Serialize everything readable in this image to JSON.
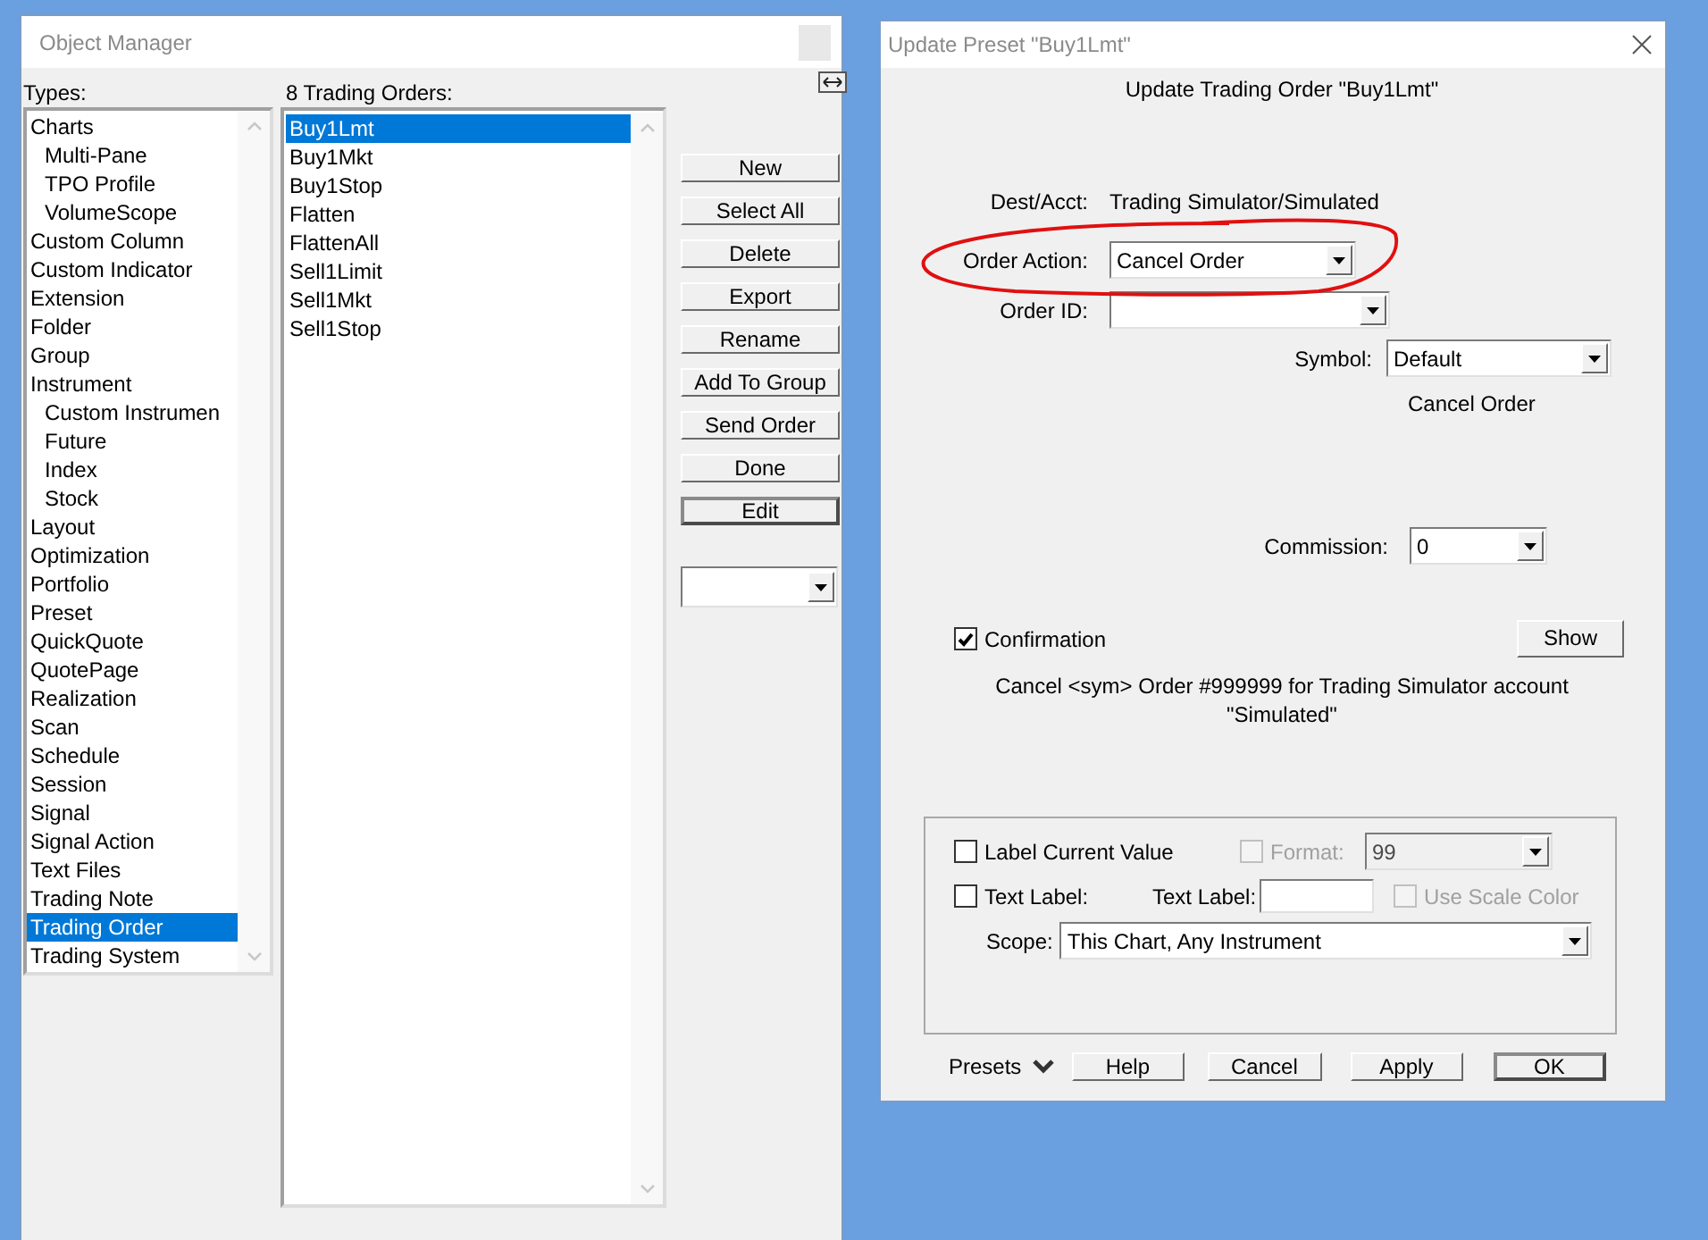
{
  "object_manager": {
    "title": "Object Manager",
    "types_label": "Types:",
    "types": [
      {
        "label": "Charts",
        "selected": false,
        "children": [
          {
            "label": "Multi-Pane",
            "selected": false
          },
          {
            "label": "TPO Profile",
            "selected": false
          },
          {
            "label": "VolumeScope",
            "selected": false
          }
        ]
      },
      {
        "label": "Custom Column",
        "selected": false
      },
      {
        "label": "Custom Indicator",
        "selected": false
      },
      {
        "label": "Extension",
        "selected": false
      },
      {
        "label": "Folder",
        "selected": false
      },
      {
        "label": "Group",
        "selected": false
      },
      {
        "label": "Instrument",
        "selected": false,
        "children": [
          {
            "label": "Custom Instrumen",
            "selected": false
          },
          {
            "label": "Future",
            "selected": false
          },
          {
            "label": "Index",
            "selected": false
          },
          {
            "label": "Stock",
            "selected": false
          }
        ]
      },
      {
        "label": "Layout",
        "selected": false
      },
      {
        "label": "Optimization",
        "selected": false
      },
      {
        "label": "Portfolio",
        "selected": false
      },
      {
        "label": "Preset",
        "selected": false
      },
      {
        "label": "QuickQuote",
        "selected": false
      },
      {
        "label": "QuotePage",
        "selected": false
      },
      {
        "label": "Realization",
        "selected": false
      },
      {
        "label": "Scan",
        "selected": false
      },
      {
        "label": "Schedule",
        "selected": false
      },
      {
        "label": "Session",
        "selected": false
      },
      {
        "label": "Signal",
        "selected": false
      },
      {
        "label": "Signal Action",
        "selected": false
      },
      {
        "label": "Text Files",
        "selected": false
      },
      {
        "label": "Trading Note",
        "selected": false
      },
      {
        "label": "Trading Order",
        "selected": true
      },
      {
        "label": "Trading System",
        "selected": false
      }
    ],
    "orders_label": "8 Trading Orders:",
    "orders": [
      {
        "label": "Buy1Lmt",
        "selected": true
      },
      {
        "label": "Buy1Mkt",
        "selected": false
      },
      {
        "label": "Buy1Stop",
        "selected": false
      },
      {
        "label": "Flatten",
        "selected": false
      },
      {
        "label": "FlattenAll",
        "selected": false
      },
      {
        "label": "Sell1Limit",
        "selected": false
      },
      {
        "label": "Sell1Mkt",
        "selected": false
      },
      {
        "label": "Sell1Stop",
        "selected": false
      }
    ],
    "buttons": [
      {
        "label": "New",
        "default": false
      },
      {
        "label": "Select All",
        "default": false
      },
      {
        "label": "Delete",
        "default": false
      },
      {
        "label": "Export",
        "default": false
      },
      {
        "label": "Rename",
        "default": false
      },
      {
        "label": "Add To Group",
        "default": false
      },
      {
        "label": "Send Order",
        "default": false
      },
      {
        "label": "Done",
        "default": false
      },
      {
        "label": "Edit",
        "default": true
      }
    ]
  },
  "dialog": {
    "title": "Update Preset \"Buy1Lmt\"",
    "heading": "Update Trading Order \"Buy1Lmt\"",
    "dest": {
      "label": "Dest/Acct:",
      "value": "Trading Simulator/Simulated"
    },
    "order_action": {
      "label": "Order Action:",
      "value": "Cancel Order"
    },
    "order_id": {
      "label": "Order ID:"
    },
    "symbol": {
      "label": "Symbol:",
      "value": "Default"
    },
    "symbol_note": "Cancel Order",
    "commission": {
      "label": "Commission:",
      "value": "0"
    },
    "confirmation": {
      "label": "Confirmation",
      "checked": true
    },
    "show_button": "Show",
    "message_lines": [
      "Cancel <sym> Order #999999 for Trading Simulator account",
      "\"Simulated\""
    ],
    "label_current_value": {
      "label": "Label Current Value",
      "checked": false
    },
    "format": {
      "label": "Format:",
      "checked": false,
      "disabled": true,
      "value": "99"
    },
    "text_label_check": {
      "label": "Text Label:",
      "checked": false
    },
    "text_label_field": {
      "label": "Text Label:"
    },
    "use_scale_color": {
      "label": "Use Scale Color",
      "checked": false,
      "disabled": true
    },
    "scope": {
      "label": "Scope:",
      "value": "This Chart, Any Instrument"
    },
    "presets": "Presets",
    "buttons": [
      {
        "label": "Help",
        "default": false
      },
      {
        "label": "Cancel",
        "default": false
      },
      {
        "label": "Apply",
        "default": false
      },
      {
        "label": "OK",
        "default": true
      }
    ]
  }
}
